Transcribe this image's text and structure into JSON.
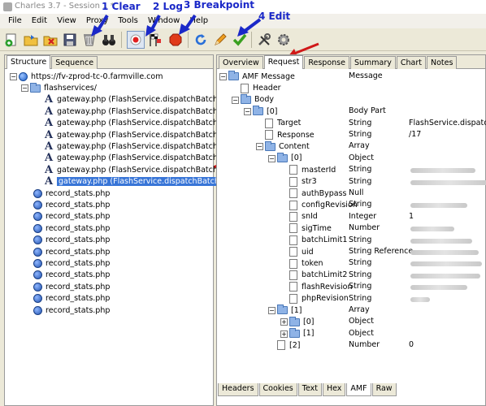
{
  "window": {
    "title": "Charles 3.7 - Session 1 *"
  },
  "menu": [
    "File",
    "Edit",
    "View",
    "Proxy",
    "Tools",
    "Window",
    "Help"
  ],
  "annotations": {
    "a1": "1 Clear",
    "a2": "2 Log",
    "a3": "3 Breakpoint",
    "a4": "4 Edit"
  },
  "left_tabs": [
    "Structure",
    "Sequence"
  ],
  "tree": {
    "host": "https://fv-zprod-tc-0.farmville.com",
    "folder": "flashservices/",
    "gateway_items": [
      "gateway.php (FlashService.dispatchBatch)",
      "gateway.php (FlashService.dispatchBatch)",
      "gateway.php (FlashService.dispatchBatch)",
      "gateway.php (FlashService.dispatchBatch)",
      "gateway.php (FlashService.dispatchBatch)",
      "gateway.php (FlashService.dispatchBatch)",
      "gateway.php (FlashService.dispatchBatch)",
      "gateway.php (FlashService.dispatchBatch)"
    ],
    "record_items": [
      "record_stats.php",
      "record_stats.php",
      "record_stats.php",
      "record_stats.php",
      "record_stats.php",
      "record_stats.php",
      "record_stats.php",
      "record_stats.php",
      "record_stats.php",
      "record_stats.php",
      "record_stats.php"
    ]
  },
  "right_tabs": [
    "Overview",
    "Request",
    "Response",
    "Summary",
    "Chart",
    "Notes"
  ],
  "amf": [
    {
      "name": "AMF Message",
      "type": "Message",
      "value": ""
    },
    {
      "name": "Header",
      "type": "",
      "value": ""
    },
    {
      "name": "Body",
      "type": "",
      "value": ""
    },
    {
      "name": "[0]",
      "type": "Body Part",
      "value": ""
    },
    {
      "name": "Target",
      "type": "String",
      "value": "FlashService.dispatchBa"
    },
    {
      "name": "Response",
      "type": "String",
      "value": "/17"
    },
    {
      "name": "Content",
      "type": "Array",
      "value": ""
    },
    {
      "name": "[0]",
      "type": "Object",
      "value": ""
    },
    {
      "name": "masterId",
      "type": "String",
      "value": ""
    },
    {
      "name": "str3",
      "type": "String",
      "value": ""
    },
    {
      "name": "authBypass",
      "type": "Null",
      "value": ""
    },
    {
      "name": "configRevision",
      "type": "String",
      "value": ""
    },
    {
      "name": "snId",
      "type": "Integer",
      "value": "1"
    },
    {
      "name": "sigTime",
      "type": "Number",
      "value": ""
    },
    {
      "name": "batchLimit1",
      "type": "String",
      "value": ""
    },
    {
      "name": "uid",
      "type": "String Reference",
      "value": ""
    },
    {
      "name": "token",
      "type": "String",
      "value": ""
    },
    {
      "name": "batchLimit2",
      "type": "String",
      "value": ""
    },
    {
      "name": "flashRevision",
      "type": "String",
      "value": ""
    },
    {
      "name": "phpRevision",
      "type": "String",
      "value": ""
    },
    {
      "name": "[1]",
      "type": "Array",
      "value": ""
    },
    {
      "name": "[0]",
      "type": "Object",
      "value": ""
    },
    {
      "name": "[1]",
      "type": "Object",
      "value": ""
    },
    {
      "name": "[2]",
      "type": "Number",
      "value": "0"
    }
  ],
  "bottom_tabs": [
    "Headers",
    "Cookies",
    "Text",
    "Hex",
    "AMF",
    "Raw"
  ],
  "colors": {
    "annotation": "#1a28c8",
    "arrow": "#d01818",
    "selection": "#3875d7"
  }
}
